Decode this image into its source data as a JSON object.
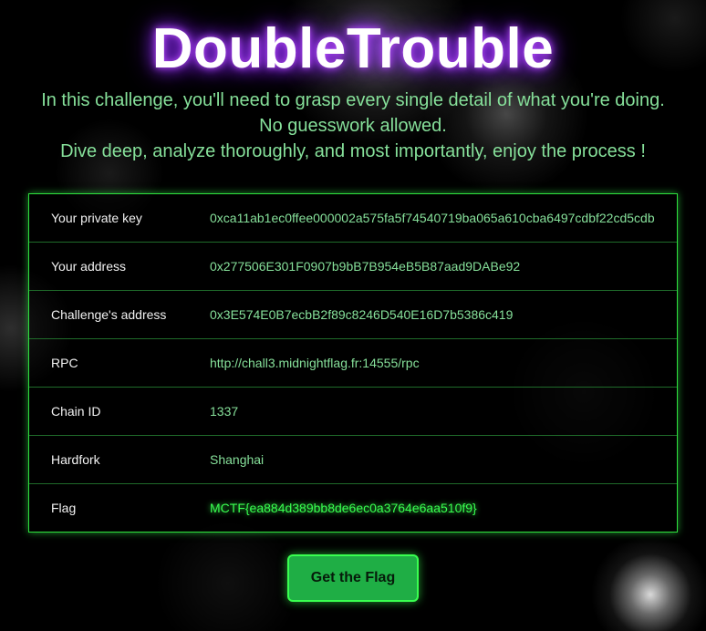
{
  "header": {
    "title": "DoubleTrouble",
    "intro_lines": [
      "In this challenge, you'll need to grasp every single detail of what you're doing.",
      "No guesswork allowed.",
      "Dive deep, analyze thoroughly, and most importantly, enjoy the process !"
    ]
  },
  "info": {
    "rows": [
      {
        "label": "Your private key",
        "value": "0xca11ab1ec0ffee000002a575fa5f74540719ba065a610cba6497cdbf22cd5cdb"
      },
      {
        "label": "Your address",
        "value": "0x277506E301F0907b9bB7B954eB5B87aad9DABe92"
      },
      {
        "label": "Challenge's address",
        "value": "0x3E574E0B7ecbB2f89c8246D540E16D7b5386c419"
      },
      {
        "label": "RPC",
        "value": "http://chall3.midnightflag.fr:14555/rpc"
      },
      {
        "label": "Chain ID",
        "value": "1337"
      },
      {
        "label": "Hardfork",
        "value": "Shanghai"
      },
      {
        "label": "Flag",
        "value": "MCTF{ea884d389bb8de6ec0a3764e6aa510f9}"
      }
    ]
  },
  "actions": {
    "get_flag_label": "Get the Flag"
  },
  "colors": {
    "title_glow": "#9b30ff",
    "text_green": "#86e09a",
    "accent_green": "#39ff50",
    "button_bg": "#1fae45"
  }
}
